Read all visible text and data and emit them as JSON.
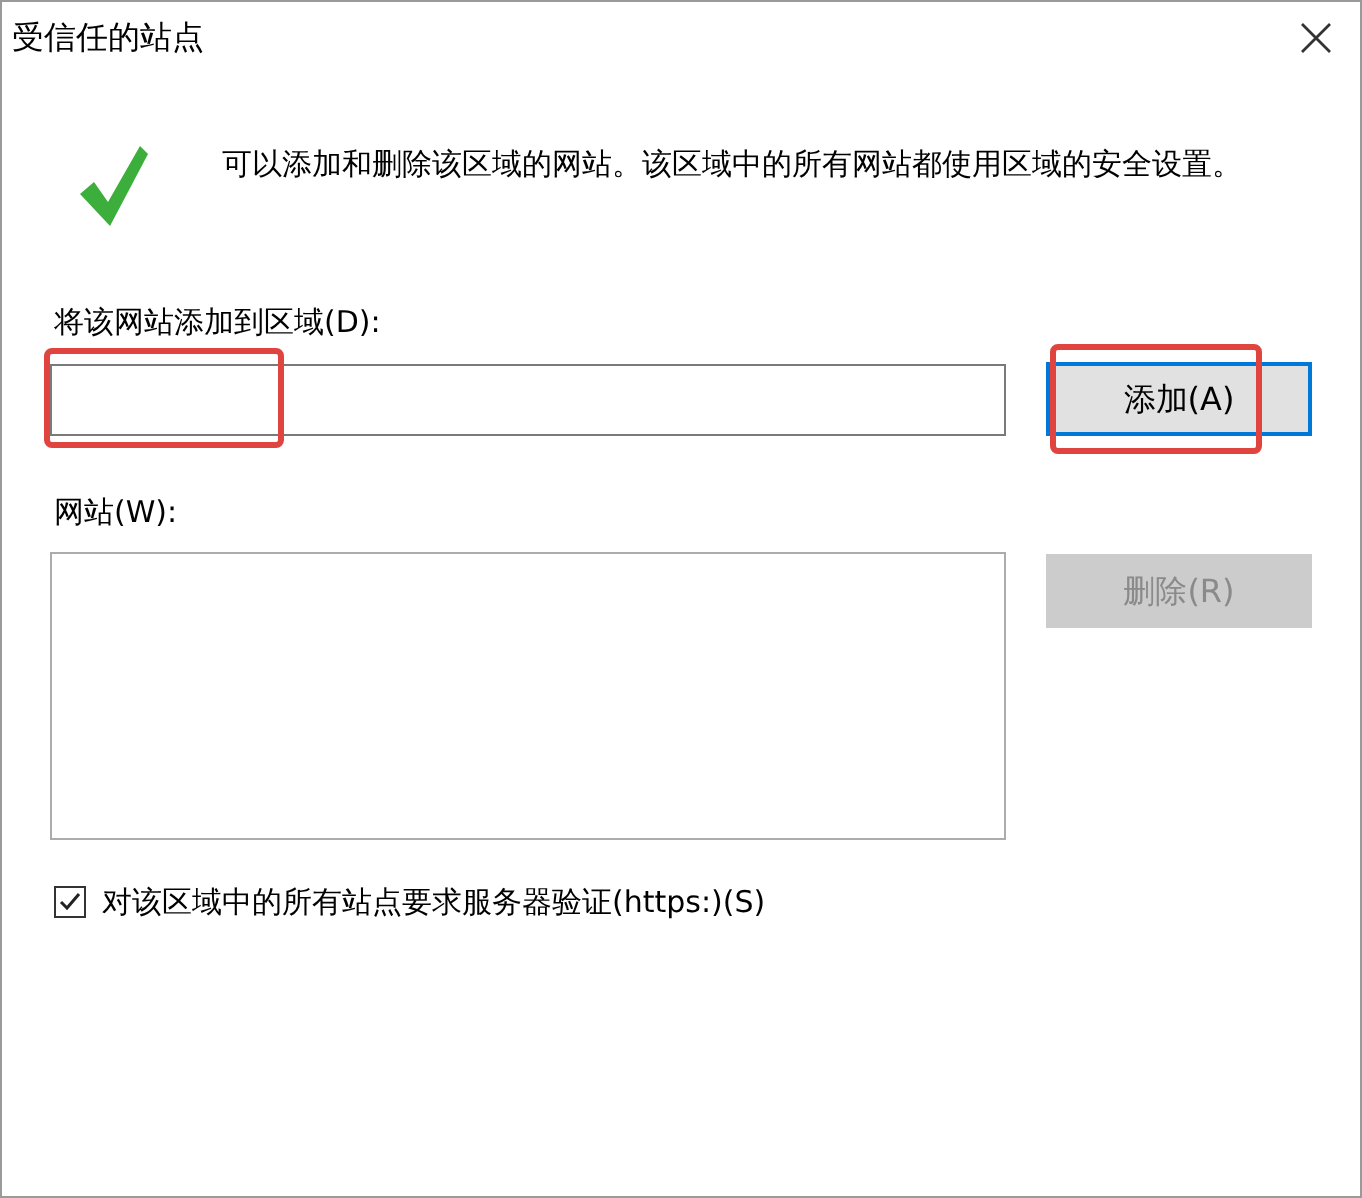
{
  "window": {
    "title": "受信任的站点"
  },
  "message": "可以添加和删除该区域的网站。该区域中的所有网站都使用区域的安全设置。",
  "add_label": "将该网站添加到区域(D):",
  "add_button": {
    "label": "添加(A)",
    "disabled": false,
    "highlighted": true
  },
  "sites_label": "网站(W):",
  "remove_button": {
    "label": "删除(R)",
    "disabled": true
  },
  "https_checkbox": {
    "label": "对该区域中的所有站点要求服务器验证(https:)(S)",
    "checked": true
  },
  "field_highlighted": true
}
